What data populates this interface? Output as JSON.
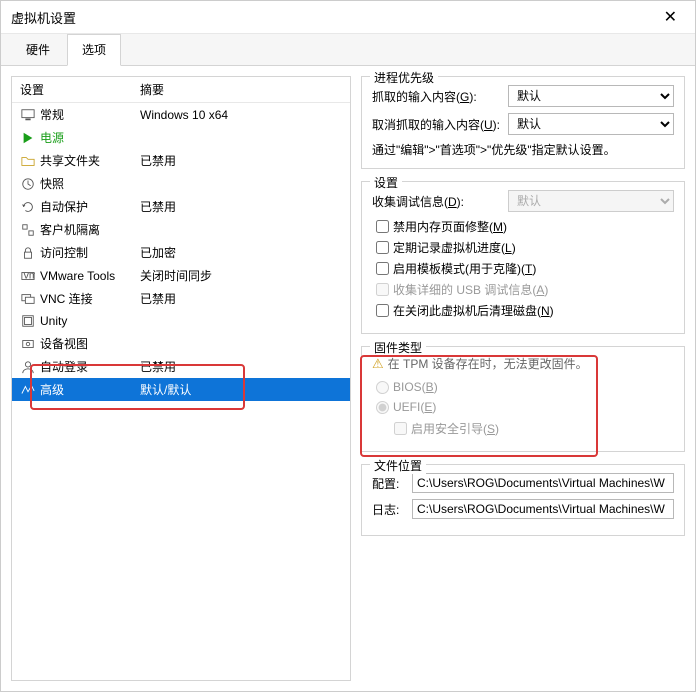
{
  "window": {
    "title": "虚拟机设置"
  },
  "tabs": {
    "hardware": "硬件",
    "options": "选项"
  },
  "listHeader": {
    "setting": "设置",
    "summary": "摘要"
  },
  "rows": [
    {
      "id": "general",
      "label": "常规",
      "summary": "Windows 10 x64"
    },
    {
      "id": "power",
      "label": "电源",
      "summary": ""
    },
    {
      "id": "shared",
      "label": "共享文件夹",
      "summary": "已禁用"
    },
    {
      "id": "snapshot",
      "label": "快照",
      "summary": ""
    },
    {
      "id": "autoprot",
      "label": "自动保护",
      "summary": "已禁用"
    },
    {
      "id": "guestiso",
      "label": "客户机隔离",
      "summary": ""
    },
    {
      "id": "access",
      "label": "访问控制",
      "summary": "已加密"
    },
    {
      "id": "vmtools",
      "label": "VMware Tools",
      "summary": "关闭时间同步"
    },
    {
      "id": "vnc",
      "label": "VNC 连接",
      "summary": "已禁用"
    },
    {
      "id": "unity",
      "label": "Unity",
      "summary": ""
    },
    {
      "id": "devview",
      "label": "设备视图",
      "summary": ""
    },
    {
      "id": "autologin",
      "label": "自动登录",
      "summary": "已禁用"
    },
    {
      "id": "advanced",
      "label": "高级",
      "summary": "默认/默认"
    }
  ],
  "priority": {
    "groupTitle": "进程优先级",
    "grabLabel": "抓取的输入内容(G):",
    "grabValue": "默认",
    "ungrabLabel": "取消抓取的输入内容(U):",
    "ungrabValue": "默认",
    "note": "通过\"编辑\">\"首选项\">\"优先级\"指定默认设置。"
  },
  "settings": {
    "groupTitle": "设置",
    "debugLabel": "收集调试信息(D):",
    "debugValue": "默认",
    "cb1": "禁用内存页面修整(M)",
    "cb2": "定期记录虚拟机进度(L)",
    "cb3": "启用模板模式(用于克隆)(T)",
    "cb4": "收集详细的 USB 调试信息(A)",
    "cb5": "在关闭此虚拟机后清理磁盘(N)"
  },
  "firmware": {
    "groupTitle": "固件类型",
    "warning": "在 TPM 设备存在时，无法更改固件。",
    "bios": "BIOS(B)",
    "uefi": "UEFI(E)",
    "secureBoot": "启用安全引导(S)"
  },
  "filelocation": {
    "groupTitle": "文件位置",
    "configLabel": "配置:",
    "configValue": "C:\\Users\\ROG\\Documents\\Virtual Machines\\W",
    "logLabel": "日志:",
    "logValue": "C:\\Users\\ROG\\Documents\\Virtual Machines\\W"
  }
}
